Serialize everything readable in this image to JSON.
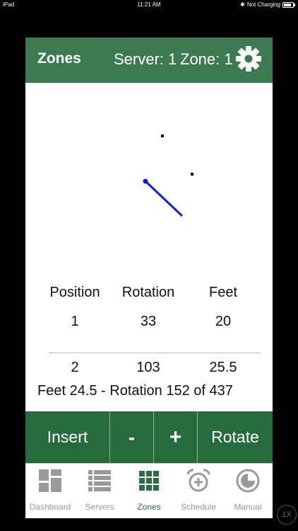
{
  "status_bar": {
    "device": "iPad",
    "time": "11:21 AM",
    "charging": "Not Charging"
  },
  "header": {
    "title": "Zones",
    "server": "Server: 1",
    "zone": "Zone: 1",
    "settings_icon": "gear-icon"
  },
  "zone_plot": {
    "line_color": "#0a1fe0",
    "dot_color": "#000000"
  },
  "table": {
    "headers": [
      "Position",
      "Rotation",
      "Feet"
    ],
    "rows": [
      [
        "1",
        "33",
        "20"
      ],
      [
        "2",
        "103",
        "25.5"
      ]
    ]
  },
  "status_line": "Feet 24.5 - Rotation 152 of 437",
  "actions": {
    "insert": "Insert",
    "minus": "-",
    "plus": "+",
    "rotate": "Rotate"
  },
  "tabs": [
    {
      "label": "Dashboard",
      "icon": "dashboard-icon"
    },
    {
      "label": "Servers",
      "icon": "servers-icon"
    },
    {
      "label": "Zones",
      "icon": "zones-icon"
    },
    {
      "label": "Schedule",
      "icon": "schedule-icon"
    },
    {
      "label": "Manual",
      "icon": "manual-icon"
    }
  ],
  "zoom": "1X",
  "colors": {
    "header": "#3d7a50",
    "actionbar": "#256b3c",
    "active_tab": "#2b6e43"
  }
}
